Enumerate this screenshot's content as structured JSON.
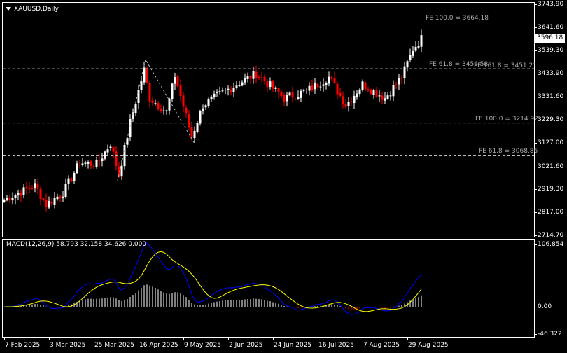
{
  "window": {
    "symbol_title": "XAUUSD,Daily"
  },
  "price_axis": {
    "labels": [
      "3743.90",
      "3641.60",
      "3539.30",
      "3433.90",
      "3331.60",
      "3229.30",
      "3127.00",
      "3021.60",
      "2919.30",
      "2817.00",
      "2714.70"
    ],
    "current_price": "3596.18"
  },
  "macd_axis": {
    "labels": [
      "106.854",
      "0.00",
      "-46.322"
    ]
  },
  "macd_label": "MACD(12,26,9) 58.793 32.158 34.626 0.000",
  "date_axis": {
    "labels": [
      "7 Feb 2025",
      "3 Mar 2025",
      "25 Mar 2025",
      "16 Apr 2025",
      "9 May 2025",
      "2 Jun 2025",
      "24 Jun 2025",
      "16 Jul 2025",
      "7 Aug 2025",
      "29 Aug 2025"
    ]
  },
  "fibo_levels": [
    {
      "label": "FE 100.0 = 3664.18",
      "price": 3664.18
    },
    {
      "label": "FE 61.8 = 3456.58",
      "price": 3456.58
    },
    {
      "label": "FE 161.8 = 3451.21",
      "price": 3451.21
    },
    {
      "label": "FE 100.0 = 3214.92",
      "price": 3214.92
    },
    {
      "label": "FE 61.8 = 3068.86",
      "price": 3068.86
    }
  ],
  "colors": {
    "bull": "#ffffff",
    "bear": "#ff0000",
    "macd": "#0000ff",
    "signal": "#ffff00",
    "background": "#000000"
  },
  "chart_data": {
    "type": "candlestick",
    "title": "XAUUSD,Daily",
    "ylim": [
      2714.7,
      3743.9
    ],
    "approx_close_knots": [
      [
        0,
        2874
      ],
      [
        11,
        2936
      ],
      [
        15,
        2852
      ],
      [
        21,
        2905
      ],
      [
        27,
        3039
      ],
      [
        33,
        3030
      ],
      [
        38,
        3123
      ],
      [
        41,
        2983
      ],
      [
        45,
        3217
      ],
      [
        50,
        3451
      ],
      [
        52,
        3326
      ],
      [
        58,
        3264
      ],
      [
        61,
        3426
      ],
      [
        67,
        3154
      ],
      [
        71,
        3295
      ],
      [
        81,
        3373
      ],
      [
        90,
        3435
      ],
      [
        100,
        3326
      ],
      [
        108,
        3357
      ],
      [
        116,
        3419
      ],
      [
        122,
        3295
      ],
      [
        128,
        3388
      ],
      [
        136,
        3326
      ],
      [
        142,
        3419
      ],
      [
        146,
        3544
      ],
      [
        149,
        3591
      ]
    ],
    "macd_params": [
      12,
      26,
      9
    ],
    "macd_ylim": [
      -46.322,
      106.854
    ]
  }
}
